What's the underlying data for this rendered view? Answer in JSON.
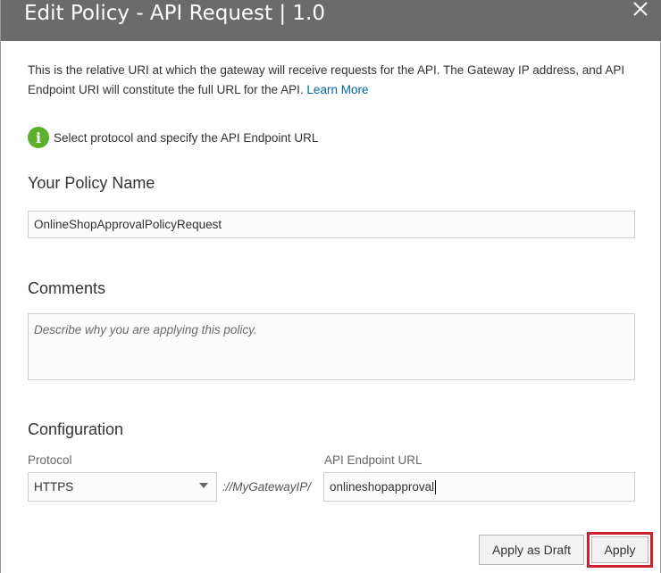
{
  "dialog": {
    "title": "Edit Policy - API Request | 1.0",
    "description": "This is the relative URI at which the gateway will receive requests for the API. The Gateway IP address, and API Endpoint URI will constitute the full URL for the API.",
    "learn_more": "Learn More",
    "info_text": "Select protocol and specify the API Endpoint URL"
  },
  "policy_name": {
    "heading": "Your Policy Name",
    "value": "OnlineShopApprovalPolicyRequest"
  },
  "comments": {
    "heading": "Comments",
    "placeholder": "Describe why you are applying this policy."
  },
  "configuration": {
    "heading": "Configuration",
    "protocol_label": "Protocol",
    "protocol_value": "HTTPS",
    "separator": "://MyGatewayIP/",
    "endpoint_label": "API Endpoint URL",
    "endpoint_value": "onlineshopapproval"
  },
  "buttons": {
    "apply_draft": "Apply as Draft",
    "apply": "Apply"
  },
  "icons": {
    "close": "close-icon",
    "info": "info-icon",
    "dropdown": "chevron-down-icon"
  },
  "colors": {
    "titlebar": "#6b6b6b",
    "link": "#0066a0",
    "info": "#5cb02c",
    "highlight": "#d1202d"
  }
}
